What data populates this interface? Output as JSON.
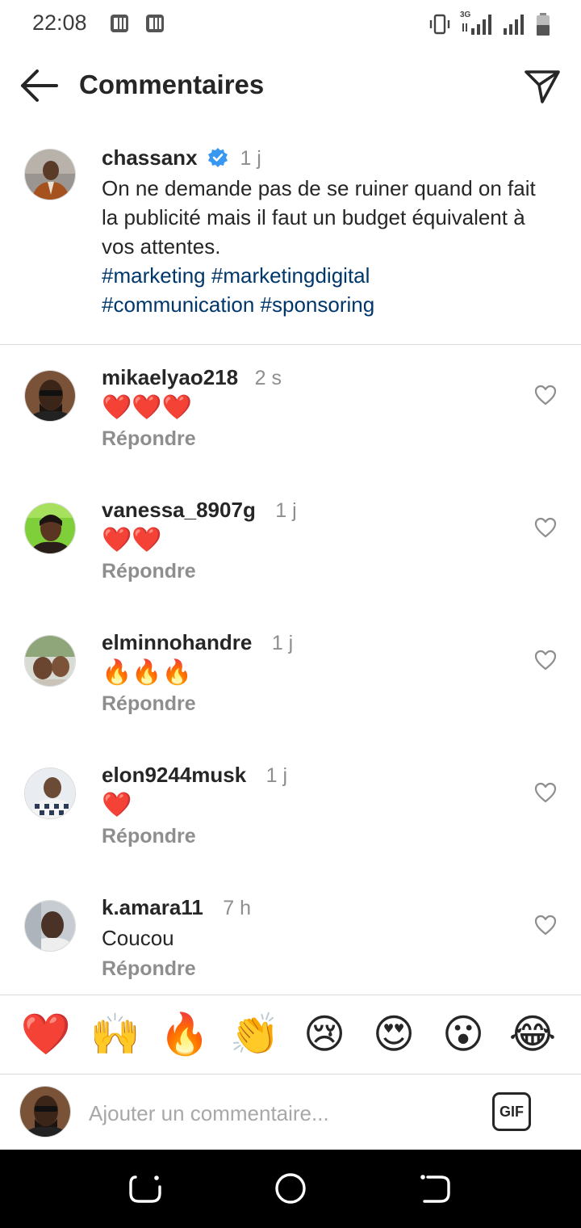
{
  "status_bar": {
    "time": "22:08",
    "network_label": "3G",
    "left_icons": [
      "app-notification-icon",
      "app-notification-icon"
    ],
    "right_icons": [
      "vibrate-icon",
      "signal-icon",
      "signal-icon",
      "battery-icon"
    ]
  },
  "header": {
    "title": "Commentaires",
    "back_icon": "arrow-left-icon",
    "share_icon": "paper-plane-icon"
  },
  "caption": {
    "username": "chassanx",
    "verified": true,
    "time": "1 j",
    "text": "On ne demande pas de se ruiner quand on fait la publicité mais il faut un budget équivalent à vos attentes.",
    "hashtags": [
      "#marketing",
      "#marketingdigital",
      "#communication",
      "#sponsoring"
    ]
  },
  "comments": [
    {
      "username": "mikaelyao218",
      "time": "2 s",
      "text": "❤️❤️❤️",
      "reply_label": "Répondre"
    },
    {
      "username": "vanessa_8907g",
      "time": "1 j",
      "text": "❤️❤️",
      "reply_label": "Répondre"
    },
    {
      "username": "elminnohandre",
      "time": "1 j",
      "text": "🔥🔥🔥",
      "reply_label": "Répondre"
    },
    {
      "username": "elon9244musk",
      "time": "1 j",
      "text": "❤️",
      "reply_label": "Répondre"
    },
    {
      "username": "k.amara11",
      "time": "7 h",
      "text": "Coucou",
      "reply_label": "Répondre"
    }
  ],
  "quick_reactions": [
    "❤️",
    "🙌",
    "🔥",
    "👏",
    "😢",
    "😍",
    "😮",
    "😂"
  ],
  "composer": {
    "placeholder": "Ajouter un commentaire...",
    "gif_label": "GIF"
  },
  "colors": {
    "text": "#262626",
    "secondary": "#8e8e8e",
    "hashtag": "#00376b",
    "verified": "#3897f0",
    "nav_bar": "#000000"
  }
}
